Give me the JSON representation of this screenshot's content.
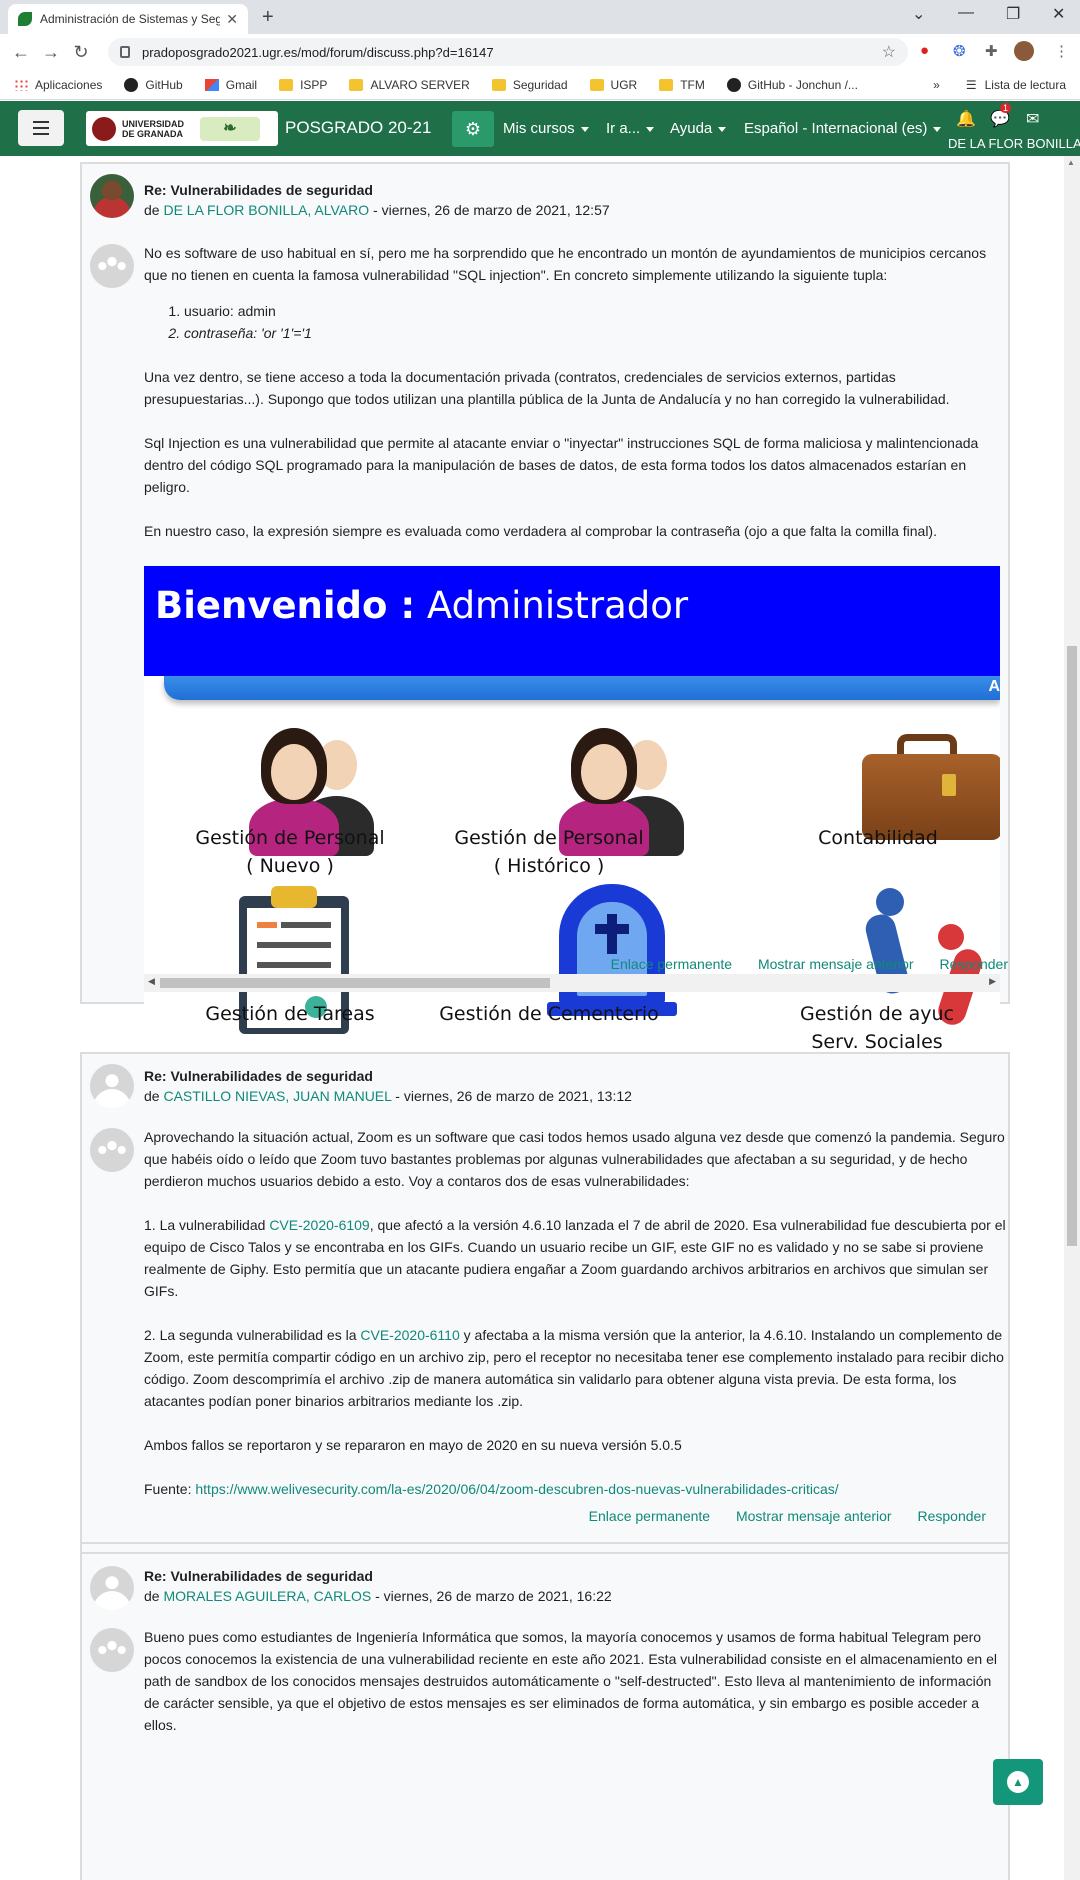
{
  "browser": {
    "tab_title": "Administración de Sistemas y Seg",
    "new_tab": "+",
    "url": "pradoposgrado2021.ugr.es/mod/forum/discuss.php?d=16147",
    "bookmarks": [
      "Aplicaciones",
      "GitHub",
      "Gmail",
      "ISPP",
      "ALVARO SERVER",
      "Seguridad",
      "UGR",
      "TFM",
      "GitHub - Jonchun /..."
    ],
    "bookmarks_more": "»",
    "reading_list": "Lista de lectura"
  },
  "navbar": {
    "logo_text": "UNIVERSIDAD DE GRANADA",
    "site_name": "POSGRADO 20-21",
    "menus": [
      "Mis cursos",
      "Ir a...",
      "Ayuda",
      "Español - Internacional (es)"
    ],
    "username": "DE LA FLOR BONILLA, ALVARO",
    "notification_count": "1"
  },
  "posts": [
    {
      "subject": "Re: Vulnerabilidades de seguridad",
      "by_prefix": "de",
      "author": "DE LA FLOR BONILLA, ALVARO",
      "date": " - viernes, 26 de marzo de 2021, 12:57",
      "paragraphs": [
        "No es software de uso habitual en sí, pero me ha sorprendido que he encontrado un montón de ayundamientos de municipios cercanos que no tienen en cuenta la famosa vulnerabilidad \"SQL injection\". En concreto simplemente utilizando la siguiente tupla:",
        "Una vez dentro, se tiene acceso a toda la documentación privada (contratos, credenciales de servicios externos, partidas presupuestarias...). Supongo que todos utilizan una plantilla pública de la Junta de Andalucía y no han corregido la vulnerabilidad.",
        "Sql Injection es una vulnerabilidad que permite al atacante enviar o \"inyectar\" instrucciones SQL de forma maliciosa y malintencionada dentro del código SQL programado para la manipulación de bases de datos, de esta forma todos los datos almacenados estarían en peligro.",
        "En nuestro caso, la expresión siempre es evaluada como verdadera al comprobar la contraseña (ojo a que falta la comilla final)."
      ],
      "list": [
        "usuario: admin",
        "contraseña: 'or '1'='1"
      ],
      "screenshot": {
        "banner_bold": "Bienvenido :",
        "banner_rest": " Administrador",
        "bar_text": "A",
        "tiles": [
          [
            "Gestión de Personal",
            "( Nuevo )"
          ],
          [
            "Gestión de Personal",
            "( Histórico )"
          ],
          [
            "Contabilidad",
            ""
          ],
          [
            "Gestión de Tareas",
            ""
          ],
          [
            "Gestión de Cementerio",
            ""
          ],
          [
            "Gestión de ayuc",
            "Serv. Sociales"
          ]
        ]
      },
      "commands": [
        "Enlace permanente",
        "Mostrar mensaje anterior",
        "Responder"
      ]
    },
    {
      "subject": "Re: Vulnerabilidades de seguridad",
      "by_prefix": "de",
      "author": "CASTILLO NIEVAS, JUAN MANUEL",
      "date": " - viernes, 26 de marzo de 2021, 13:12",
      "p1": "Aprovechando la situación actual, Zoom es un software que casi todos hemos usado alguna vez desde que comenzó la pandemia. Seguro que habéis oído o leído que Zoom tuvo bastantes problemas por algunas vulnerabilidades que afectaban a su seguridad, y de hecho perdieron muchos usuarios debido a esto. Voy a contaros dos de esas vulnerabilidades:",
      "p2_pre": "1. La vulnerabilidad ",
      "p2_link": "CVE-2020-6109",
      "p2_post": ", que afectó a la versión 4.6.10 lanzada el 7 de abril de 2020. Esa vulnerabilidad fue descubierta por el equipo de Cisco Talos y se encontraba en los GIFs. Cuando un usuario recibe un GIF, este GIF no es validado y no se sabe si proviene realmente de Giphy. Esto permitía que un atacante pudiera engañar a Zoom guardando archivos arbitrarios en archivos que simulan ser GIFs.",
      "p3_pre": "2. La segunda vulnerabilidad es la ",
      "p3_link": "CVE-2020-6110",
      "p3_post": " y afectaba a la misma versión que la anterior, la 4.6.10. Instalando un complemento de Zoom, este permitía compartir código en un archivo zip, pero el receptor no necesitaba tener ese complemento instalado para recibir dicho código. Zoom descomprimía el archivo .zip de manera automática sin validarlo para obtener alguna vista previa. De esta forma, los atacantes podían poner binarios arbitrarios mediante los .zip.",
      "p4": "Ambos fallos se reportaron y se repararon en mayo de 2020 en su nueva versión 5.0.5",
      "source_label": "Fuente: ",
      "source_link": "https://www.welivesecurity.com/la-es/2020/06/04/zoom-descubren-dos-nuevas-vulnerabilidades-criticas/",
      "commands": [
        "Enlace permanente",
        "Mostrar mensaje anterior",
        "Responder"
      ]
    },
    {
      "subject": "Re: Vulnerabilidades de seguridad",
      "by_prefix": "de",
      "author": "MORALES AGUILERA, CARLOS",
      "date": " - viernes, 26 de marzo de 2021, 16:22",
      "p1": "Bueno pues como estudiantes de Ingeniería Informática que somos, la mayoría conocemos y usamos de forma habitual Telegram pero pocos conocemos la existencia de una vulnerabilidad reciente en este año 2021. Esta vulnerabilidad consiste en el almacenamiento en el path de sandbox de los conocidos mensajes destruidos automáticamente o \"self-destructed\". Esto lleva al mantenimiento de información de carácter sensible, ya que el objetivo de estos mensajes es ser eliminados de forma automática, y sin embargo es posible acceder a ellos."
    }
  ],
  "colors": {
    "navbar": "#1f6f48",
    "link": "#11897a",
    "banner": "#0000ff"
  }
}
